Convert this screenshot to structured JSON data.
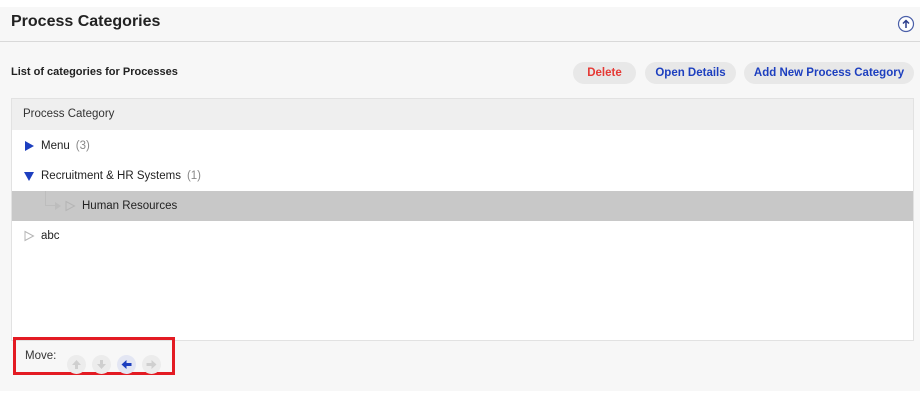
{
  "header": {
    "title": "Process Categories",
    "help_icon": "upload-help-icon"
  },
  "toolbar": {
    "subtitle": "List of categories for Processes",
    "delete_label": "Delete",
    "open_details_label": "Open Details",
    "add_label": "Add New Process Category"
  },
  "tree": {
    "column_header": "Process Category",
    "rows": [
      {
        "label": "Menu",
        "count": "(3)",
        "expanded": false,
        "has_children": true,
        "selected": false,
        "level": 0
      },
      {
        "label": "Recruitment & HR Systems",
        "count": "(1)",
        "expanded": true,
        "has_children": true,
        "selected": false,
        "level": 0
      },
      {
        "label": "Human Resources",
        "count": "",
        "expanded": false,
        "has_children": false,
        "selected": true,
        "level": 1
      },
      {
        "label": "abc",
        "count": "",
        "expanded": false,
        "has_children": false,
        "selected": false,
        "level": 0
      }
    ]
  },
  "move": {
    "label": "Move:",
    "buttons": [
      "up-arrow-icon",
      "down-arrow-icon",
      "left-arrow-icon",
      "right-arrow-icon"
    ]
  },
  "colors": {
    "accent_blue": "#1d3fbf",
    "delete_red": "#e53935",
    "highlight_red": "#e31b23",
    "selected_row": "#c8c8c8"
  }
}
